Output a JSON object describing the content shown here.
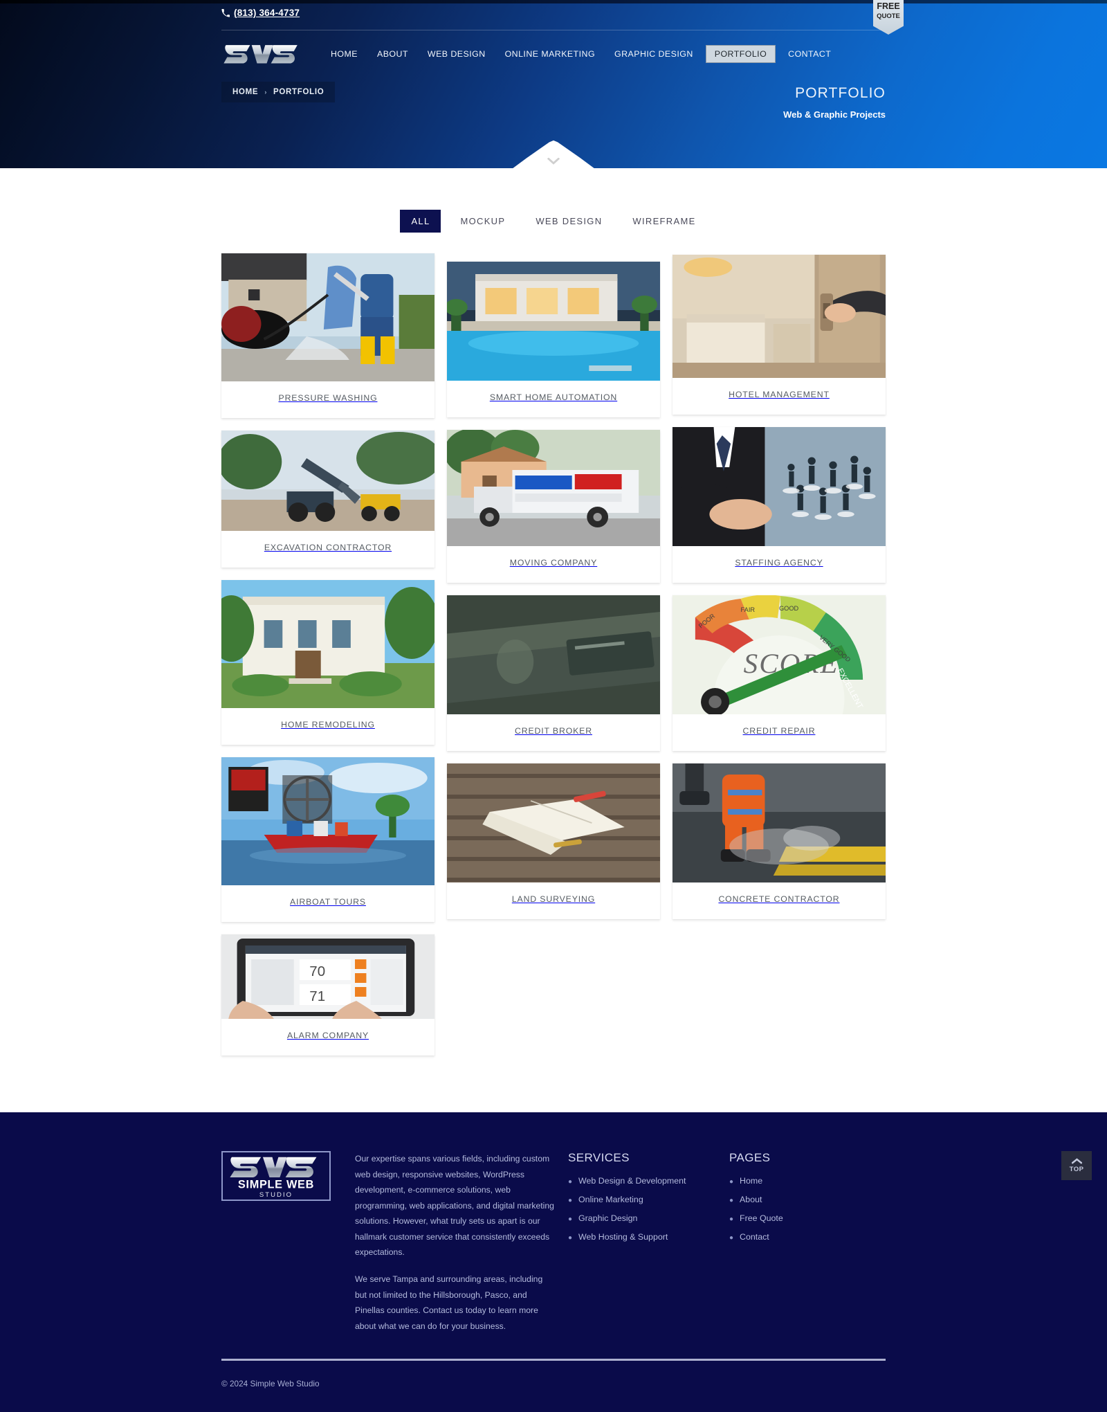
{
  "header": {
    "phone": "(813) 364-4737",
    "phone_icon": "phone-icon",
    "logo_text": "SWS",
    "nav": [
      {
        "label": "HOME",
        "active": false
      },
      {
        "label": "ABOUT",
        "active": false
      },
      {
        "label": "WEB DESIGN",
        "active": false
      },
      {
        "label": "ONLINE MARKETING",
        "active": false
      },
      {
        "label": "GRAPHIC DESIGN",
        "active": false
      },
      {
        "label": "PORTFOLIO",
        "active": true
      },
      {
        "label": "CONTACT",
        "active": false
      }
    ],
    "free_quote": {
      "line1": "FREE",
      "line2": "QUOTE"
    }
  },
  "hero": {
    "breadcrumb": {
      "home": "HOME",
      "separator": "›",
      "current": "PORTFOLIO"
    },
    "title": "PORTFOLIO",
    "subtitle": "Web & Graphic Projects",
    "scroll_icon": "chevron-down-icon"
  },
  "filters": [
    {
      "label": "ALL",
      "active": true
    },
    {
      "label": "MOCKUP",
      "active": false
    },
    {
      "label": "WEB DESIGN",
      "active": false
    },
    {
      "label": "WIREFRAME",
      "active": false
    }
  ],
  "portfolio": {
    "columns": [
      [
        {
          "caption": "PRESSURE WASHING",
          "image": "pressure-washing-photo"
        },
        {
          "caption": "EXCAVATION CONTRACTOR",
          "image": "excavation-contractor-photo"
        },
        {
          "caption": "HOME REMODELING",
          "image": "home-remodeling-photo"
        },
        {
          "caption": "AIRBOAT TOURS",
          "image": "airboat-tours-photo"
        },
        {
          "caption": "ALARM COMPANY",
          "image": "alarm-company-photo"
        }
      ],
      [
        {
          "caption": "SMART HOME AUTOMATION",
          "image": "smart-home-automation-photo"
        },
        {
          "caption": "MOVING COMPANY",
          "image": "moving-company-photo"
        },
        {
          "caption": "CREDIT BROKER",
          "image": "credit-broker-photo"
        },
        {
          "caption": "LAND SURVEYING",
          "image": "land-surveying-photo"
        }
      ],
      [
        {
          "caption": "HOTEL MANAGEMENT",
          "image": "hotel-management-photo"
        },
        {
          "caption": "STAFFING AGENCY",
          "image": "staffing-agency-photo"
        },
        {
          "caption": "CREDIT REPAIR",
          "image": "credit-repair-photo"
        },
        {
          "caption": "CONCRETE CONTRACTOR",
          "image": "concrete-contractor-photo"
        }
      ]
    ]
  },
  "footer": {
    "logo": {
      "mark": "SWS",
      "name": "SIMPLE WEB",
      "sub": "STUDIO"
    },
    "about_1": "Our expertise spans various fields, including custom web design, responsive websites, WordPress development, e-commerce solutions, web programming, web applications, and digital marketing solutions. However, what truly sets us apart is our hallmark customer service that consistently exceeds expectations.",
    "about_2": "We serve Tampa and surrounding areas, including but not limited to the Hillsborough, Pasco, and Pinellas counties. Contact us today to learn more about what we can do for your business.",
    "services": {
      "title": "SERVICES",
      "items": [
        "Web Design & Development",
        "Online Marketing",
        "Graphic Design",
        "Web Hosting & Support"
      ]
    },
    "pages": {
      "title": "PAGES",
      "items": [
        "Home",
        "About",
        "Free Quote",
        "Contact"
      ]
    },
    "copyright": "© 2024 Simple Web Studio",
    "to_top": {
      "label": "TOP",
      "icon": "chevron-up-icon"
    }
  },
  "colors": {
    "hero_dark": "#030a1c",
    "hero_light": "#0a78e3",
    "filter_active_bg": "#0d1150",
    "footer_bg": "#0a0b4a",
    "nav_active_bg": "#cfd8e0"
  }
}
